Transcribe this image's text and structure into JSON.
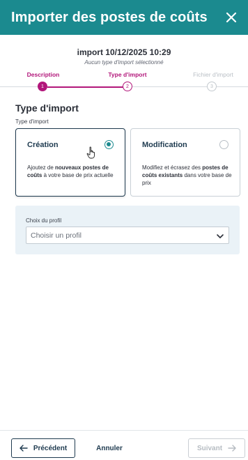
{
  "header": {
    "title": "Importer des postes de coûts",
    "close_icon": "close-icon"
  },
  "import_info": {
    "title": "import 10/12/2025 10:29",
    "note": "Aucun type d'import sélectionné"
  },
  "stepper": {
    "steps": [
      {
        "label": "Description",
        "number": "1",
        "state": "complete"
      },
      {
        "label": "Type d'import",
        "number": "2",
        "state": "current"
      },
      {
        "label": "Fichier d'import",
        "number": "3",
        "state": "pending"
      }
    ]
  },
  "section": {
    "title": "Type d'import",
    "field_label": "Type d'import"
  },
  "options": [
    {
      "title": "Création",
      "desc_parts": [
        "Ajoutez de ",
        "nouveaux postes de coûts",
        " à votre base de prix actuelle"
      ],
      "selected": true
    },
    {
      "title": "Modification",
      "desc_parts": [
        "Modifiez et écrasez des ",
        "postes de coûts existants",
        " dans votre base de prix"
      ],
      "selected": false
    }
  ],
  "profile": {
    "label": "Choix du profil",
    "placeholder": "Choisir un profil"
  },
  "footer": {
    "prev_label": "Précédent",
    "cancel_label": "Annuler",
    "next_label": "Suivant"
  },
  "colors": {
    "header_bg": "#1b8a8f",
    "step_active": "#b2167a",
    "primary_dark": "#1e3a4f",
    "radio_teal": "#1b8a8f"
  }
}
